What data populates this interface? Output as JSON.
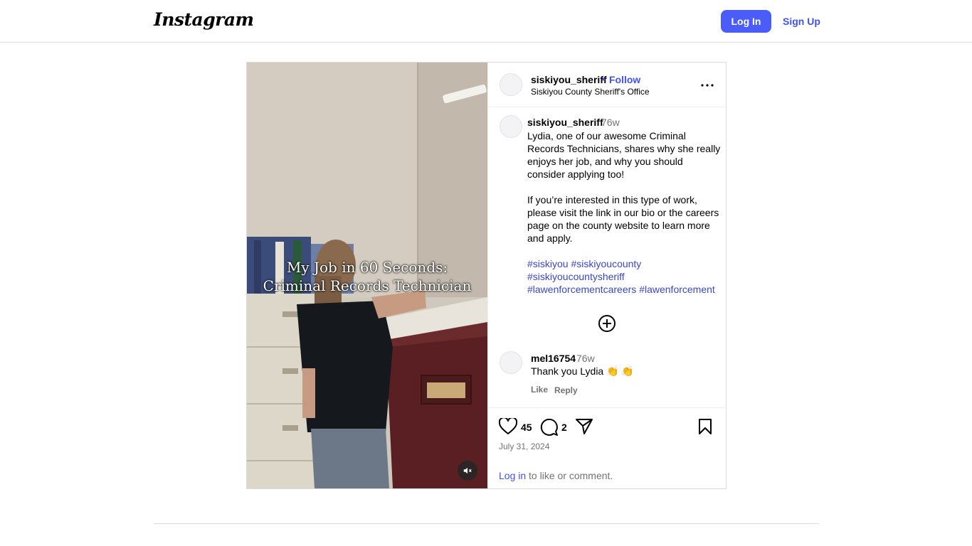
{
  "header": {
    "logo_text": "Instagram",
    "login_label": "Log In",
    "signup_label": "Sign Up"
  },
  "post": {
    "media": {
      "overlay_line1": "My Job in 60 Seconds:",
      "overlay_line2": "Criminal Records Technician",
      "muted": true
    },
    "author": {
      "username": "siskiyou_sheriff",
      "separator": "•",
      "follow_label": "Follow",
      "subtitle": "Siskiyou County Sheriff's Office"
    },
    "caption": {
      "username": "siskiyou_sheriff",
      "time": "76w",
      "paragraph1": "Lydia, one of our awesome Criminal Records Technicians, shares why she really enjoys her job, and why you should consider applying too!",
      "paragraph2": "If you’re interested in this type of work, please visit the link in our bio or the careers page on the county website to learn more and apply.",
      "hashtags": [
        "#siskiyou",
        "#siskiyoucounty",
        "#siskiyoucountysheriff",
        "#lawenforcementcareers",
        "#lawenforcement"
      ]
    },
    "comments": [
      {
        "username": "mel16754",
        "time": "76w",
        "text": "Thank you Lydia 👏 👏",
        "like_label": "Like",
        "reply_label": "Reply"
      }
    ],
    "stats": {
      "likes": "45",
      "comments": "2"
    },
    "date": "July 31, 2024",
    "login_prompt": {
      "link": "Log in",
      "rest": " to like or comment."
    }
  },
  "colors": {
    "primary_button": "#4a5df9",
    "link": "#4150f7",
    "hashtag": "#3b46c9",
    "muted_text": "#737373",
    "border": "#dbdbdb"
  },
  "icons": [
    "instagram-logo",
    "more-icon",
    "add-circle-icon",
    "heart-icon",
    "comment-icon",
    "share-icon",
    "bookmark-icon",
    "mute-icon"
  ]
}
